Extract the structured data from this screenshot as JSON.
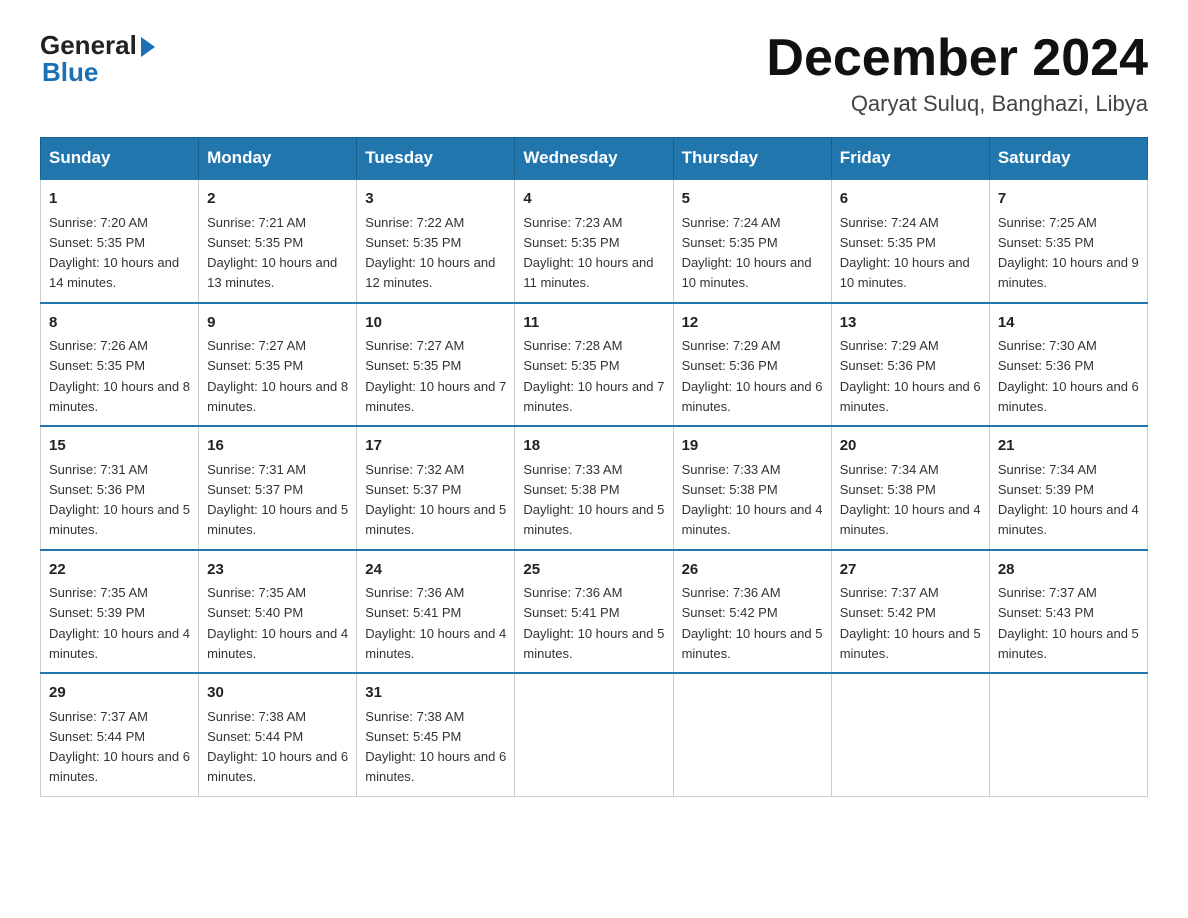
{
  "logo": {
    "general": "General",
    "blue": "Blue"
  },
  "header": {
    "month": "December 2024",
    "location": "Qaryat Suluq, Banghazi, Libya"
  },
  "days_of_week": [
    "Sunday",
    "Monday",
    "Tuesday",
    "Wednesday",
    "Thursday",
    "Friday",
    "Saturday"
  ],
  "weeks": [
    [
      {
        "day": "1",
        "sunrise": "7:20 AM",
        "sunset": "5:35 PM",
        "daylight": "10 hours and 14 minutes."
      },
      {
        "day": "2",
        "sunrise": "7:21 AM",
        "sunset": "5:35 PM",
        "daylight": "10 hours and 13 minutes."
      },
      {
        "day": "3",
        "sunrise": "7:22 AM",
        "sunset": "5:35 PM",
        "daylight": "10 hours and 12 minutes."
      },
      {
        "day": "4",
        "sunrise": "7:23 AM",
        "sunset": "5:35 PM",
        "daylight": "10 hours and 11 minutes."
      },
      {
        "day": "5",
        "sunrise": "7:24 AM",
        "sunset": "5:35 PM",
        "daylight": "10 hours and 10 minutes."
      },
      {
        "day": "6",
        "sunrise": "7:24 AM",
        "sunset": "5:35 PM",
        "daylight": "10 hours and 10 minutes."
      },
      {
        "day": "7",
        "sunrise": "7:25 AM",
        "sunset": "5:35 PM",
        "daylight": "10 hours and 9 minutes."
      }
    ],
    [
      {
        "day": "8",
        "sunrise": "7:26 AM",
        "sunset": "5:35 PM",
        "daylight": "10 hours and 8 minutes."
      },
      {
        "day": "9",
        "sunrise": "7:27 AM",
        "sunset": "5:35 PM",
        "daylight": "10 hours and 8 minutes."
      },
      {
        "day": "10",
        "sunrise": "7:27 AM",
        "sunset": "5:35 PM",
        "daylight": "10 hours and 7 minutes."
      },
      {
        "day": "11",
        "sunrise": "7:28 AM",
        "sunset": "5:35 PM",
        "daylight": "10 hours and 7 minutes."
      },
      {
        "day": "12",
        "sunrise": "7:29 AM",
        "sunset": "5:36 PM",
        "daylight": "10 hours and 6 minutes."
      },
      {
        "day": "13",
        "sunrise": "7:29 AM",
        "sunset": "5:36 PM",
        "daylight": "10 hours and 6 minutes."
      },
      {
        "day": "14",
        "sunrise": "7:30 AM",
        "sunset": "5:36 PM",
        "daylight": "10 hours and 6 minutes."
      }
    ],
    [
      {
        "day": "15",
        "sunrise": "7:31 AM",
        "sunset": "5:36 PM",
        "daylight": "10 hours and 5 minutes."
      },
      {
        "day": "16",
        "sunrise": "7:31 AM",
        "sunset": "5:37 PM",
        "daylight": "10 hours and 5 minutes."
      },
      {
        "day": "17",
        "sunrise": "7:32 AM",
        "sunset": "5:37 PM",
        "daylight": "10 hours and 5 minutes."
      },
      {
        "day": "18",
        "sunrise": "7:33 AM",
        "sunset": "5:38 PM",
        "daylight": "10 hours and 5 minutes."
      },
      {
        "day": "19",
        "sunrise": "7:33 AM",
        "sunset": "5:38 PM",
        "daylight": "10 hours and 4 minutes."
      },
      {
        "day": "20",
        "sunrise": "7:34 AM",
        "sunset": "5:38 PM",
        "daylight": "10 hours and 4 minutes."
      },
      {
        "day": "21",
        "sunrise": "7:34 AM",
        "sunset": "5:39 PM",
        "daylight": "10 hours and 4 minutes."
      }
    ],
    [
      {
        "day": "22",
        "sunrise": "7:35 AM",
        "sunset": "5:39 PM",
        "daylight": "10 hours and 4 minutes."
      },
      {
        "day": "23",
        "sunrise": "7:35 AM",
        "sunset": "5:40 PM",
        "daylight": "10 hours and 4 minutes."
      },
      {
        "day": "24",
        "sunrise": "7:36 AM",
        "sunset": "5:41 PM",
        "daylight": "10 hours and 4 minutes."
      },
      {
        "day": "25",
        "sunrise": "7:36 AM",
        "sunset": "5:41 PM",
        "daylight": "10 hours and 5 minutes."
      },
      {
        "day": "26",
        "sunrise": "7:36 AM",
        "sunset": "5:42 PM",
        "daylight": "10 hours and 5 minutes."
      },
      {
        "day": "27",
        "sunrise": "7:37 AM",
        "sunset": "5:42 PM",
        "daylight": "10 hours and 5 minutes."
      },
      {
        "day": "28",
        "sunrise": "7:37 AM",
        "sunset": "5:43 PM",
        "daylight": "10 hours and 5 minutes."
      }
    ],
    [
      {
        "day": "29",
        "sunrise": "7:37 AM",
        "sunset": "5:44 PM",
        "daylight": "10 hours and 6 minutes."
      },
      {
        "day": "30",
        "sunrise": "7:38 AM",
        "sunset": "5:44 PM",
        "daylight": "10 hours and 6 minutes."
      },
      {
        "day": "31",
        "sunrise": "7:38 AM",
        "sunset": "5:45 PM",
        "daylight": "10 hours and 6 minutes."
      },
      null,
      null,
      null,
      null
    ]
  ],
  "labels": {
    "sunrise": "Sunrise:",
    "sunset": "Sunset:",
    "daylight": "Daylight:"
  }
}
